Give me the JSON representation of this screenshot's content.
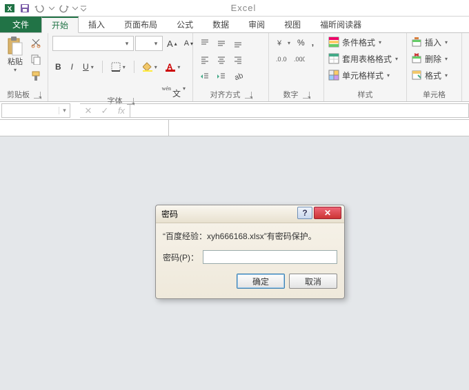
{
  "app_title": "Excel",
  "qat": {
    "excel_icon": "excel",
    "save": "save",
    "undo": "undo",
    "redo": "redo"
  },
  "tabs": {
    "file": "文件",
    "items": [
      "开始",
      "插入",
      "页面布局",
      "公式",
      "数据",
      "审阅",
      "视图",
      "福昕阅读器"
    ],
    "active_index": 0
  },
  "ribbon": {
    "clipboard": {
      "paste": "粘贴",
      "label": "剪贴板"
    },
    "font": {
      "font_name": "",
      "font_size": "",
      "bold": "B",
      "italic": "I",
      "underline": "U",
      "label": "字体"
    },
    "alignment": {
      "label": "对齐方式"
    },
    "number": {
      "percent": "%",
      "label": "数字"
    },
    "styles": {
      "cond": "条件格式",
      "table": "套用表格格式",
      "cell": "单元格样式",
      "label": "样式"
    },
    "cells": {
      "insert": "插入",
      "delete": "删除",
      "format": "格式",
      "label": "单元格"
    }
  },
  "formula_bar": {
    "name": "",
    "cancel": "✕",
    "enter": "✓",
    "fx": "fx",
    "formula": ""
  },
  "dialog": {
    "title": "密码",
    "message": "“百度经验：xyh666168.xlsx”有密码保护。",
    "field_label": "密码(P)：",
    "value": "",
    "ok": "确定",
    "cancel": "取消"
  }
}
